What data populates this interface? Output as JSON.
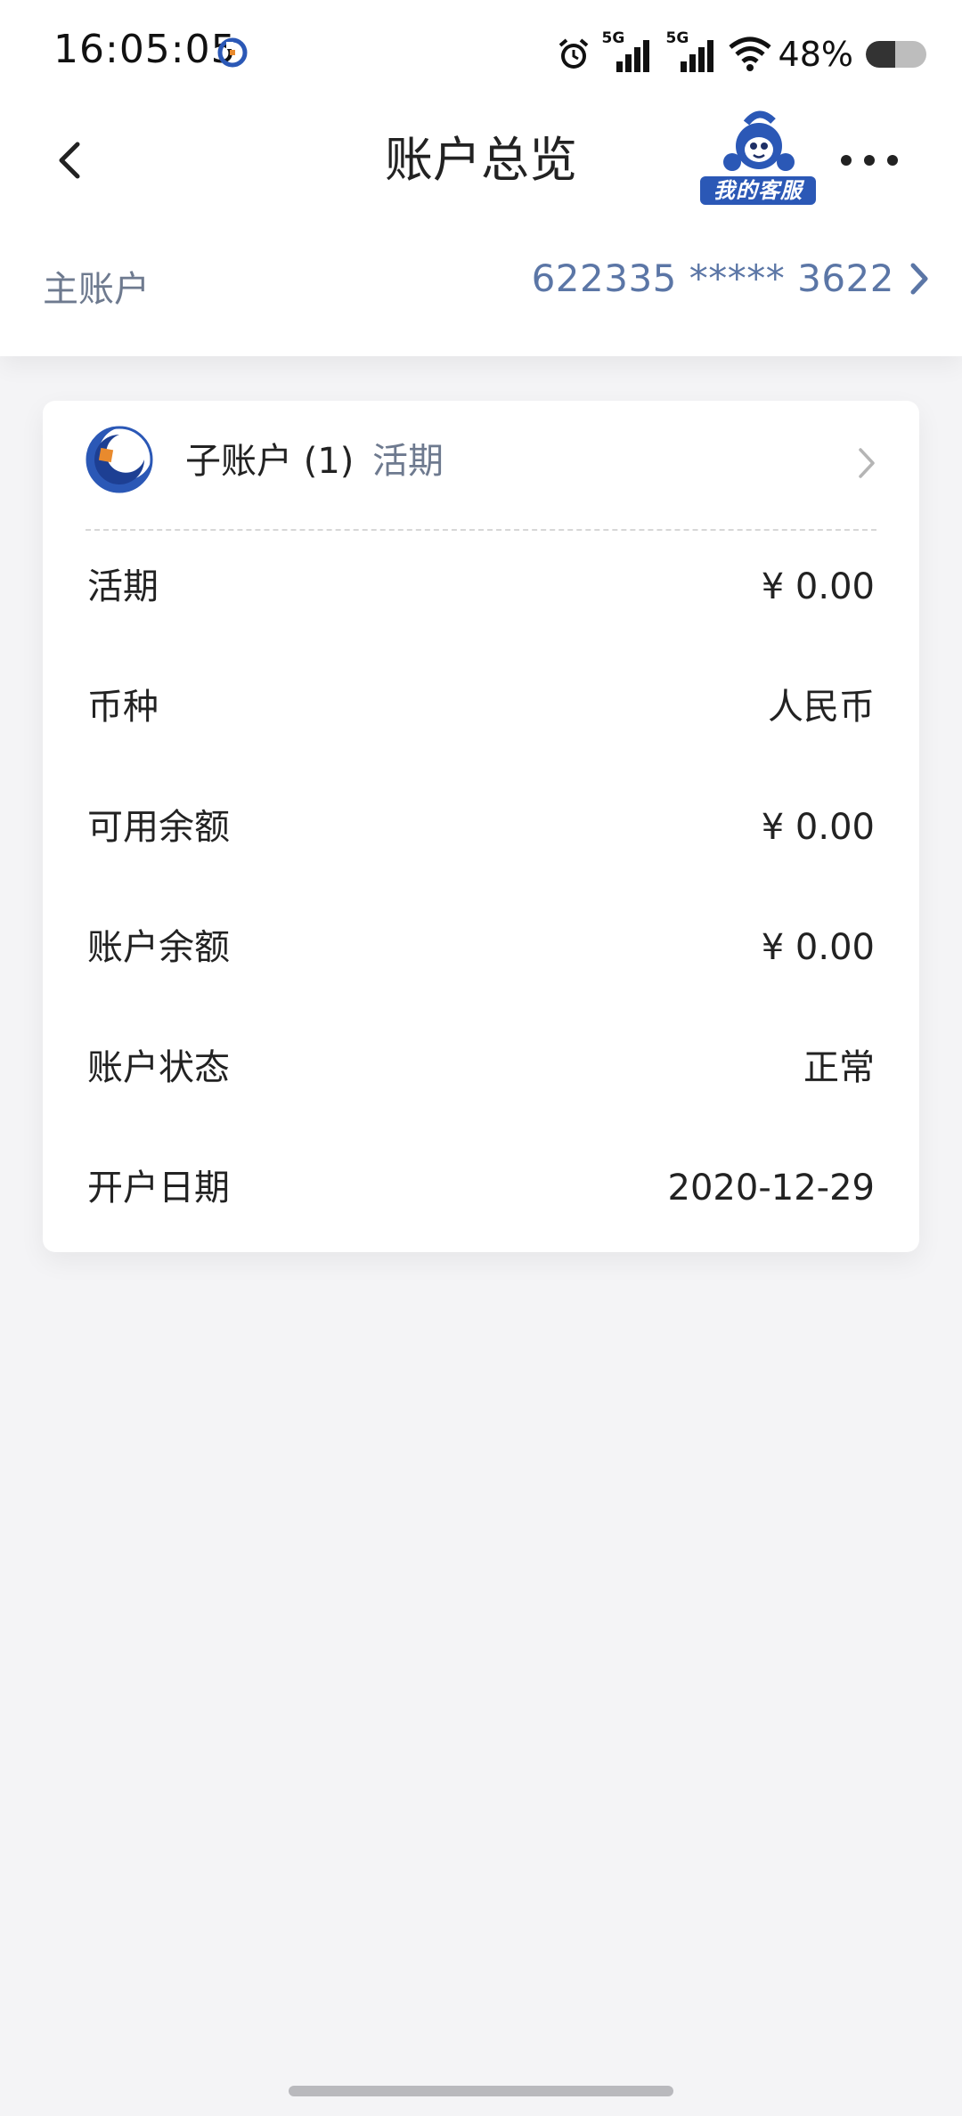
{
  "status_bar": {
    "time": "16:05:05",
    "sim1_tag": "5G",
    "sim2_tag": "5G",
    "battery_percent": "48%",
    "battery_level": 0.48
  },
  "header": {
    "title": "账户总览",
    "service_label": "我的客服"
  },
  "main_account": {
    "label": "主账户",
    "number": "622335 ***** 3622"
  },
  "sub_account": {
    "title": "子账户 (1)",
    "type": "活期",
    "rows": [
      {
        "label": "活期",
        "value": "¥ 0.00"
      },
      {
        "label": "币种",
        "value": "人民币"
      },
      {
        "label": "可用余额",
        "value": "¥ 0.00"
      },
      {
        "label": "账户余额",
        "value": "¥ 0.00"
      },
      {
        "label": "账户状态",
        "value": "正常"
      },
      {
        "label": "开户日期",
        "value": "2020-12-29"
      }
    ]
  },
  "colors": {
    "accent_blue": "#2b58b6",
    "muted_text": "#6e7a8f",
    "account_number": "#5b76a6",
    "logo_orange": "#e98a2d"
  },
  "icons": {
    "back": "chevron-left-icon",
    "more": "more-horizontal-icon",
    "service": "customer-service-mascot-icon",
    "bank": "bank-logo-icon",
    "chevron": "chevron-right-icon"
  }
}
